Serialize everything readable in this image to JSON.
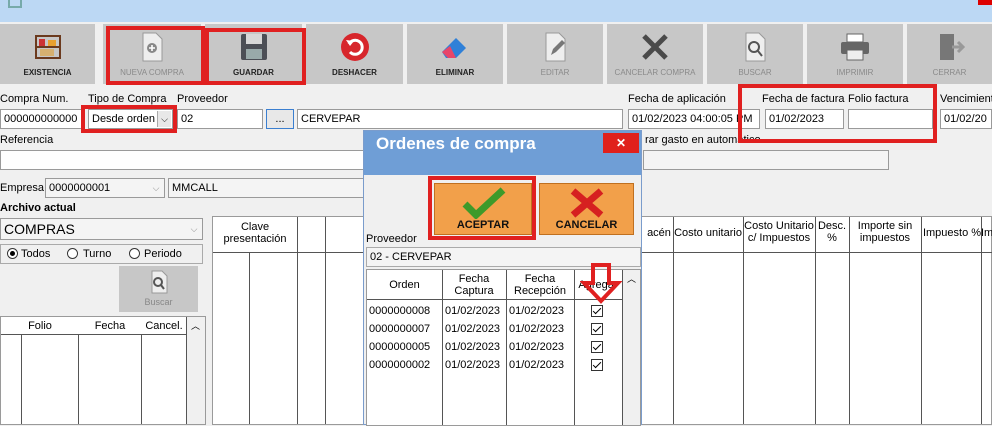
{
  "toolbar": {
    "buttons": [
      {
        "label": "EXISTENCIA",
        "icon": "shelf-icon",
        "enabled": true
      },
      {
        "label": "NUEVA COMPRA",
        "icon": "new-document-icon",
        "enabled": false
      },
      {
        "label": "GUARDAR",
        "icon": "floppy-disk-icon",
        "enabled": true
      },
      {
        "label": "DESHACER",
        "icon": "undo-icon",
        "enabled": true
      },
      {
        "label": "ELIMINAR",
        "icon": "eraser-icon",
        "enabled": true
      },
      {
        "label": "EDITAR",
        "icon": "pencil-document-icon",
        "enabled": false
      },
      {
        "label": "CANCELAR COMPRA",
        "icon": "x-icon",
        "enabled": false
      },
      {
        "label": "BUSCAR",
        "icon": "magnifier-document-icon",
        "enabled": false
      },
      {
        "label": "IMPRIMIR",
        "icon": "printer-icon",
        "enabled": false
      },
      {
        "label": "CERRAR",
        "icon": "exit-door-icon",
        "enabled": false
      }
    ]
  },
  "form": {
    "compra_num_label": "Compra Num.",
    "compra_num_value": "000000000000",
    "tipo_compra_label": "Tipo de Compra",
    "tipo_compra_value": "Desde orden",
    "proveedor_label": "Proveedor",
    "proveedor_code": "02",
    "proveedor_ellipsis": "...",
    "proveedor_name": "CERVEPAR",
    "fecha_aplicacion_label": "Fecha de aplicación",
    "fecha_aplicacion_value": "01/02/2023 04:00:05 PM",
    "fecha_factura_label": "Fecha de factura",
    "fecha_factura_value": "01/02/2023",
    "folio_factura_label": "Folio factura",
    "folio_factura_value": "",
    "vencimiento_label": "Vencimient",
    "vencimiento_value": "01/02/20",
    "referencia_label": "Referencia",
    "gasto_label": "rar gasto en automático",
    "empresa_label": "Empresa",
    "empresa_code": "0000000001",
    "empresa_name": "MMCALL",
    "archivo_actual_label": "Archivo actual",
    "archivo_actual_value": "COMPRAS",
    "radio_todos": "Todos",
    "radio_turno": "Turno",
    "radio_periodo": "Periodo",
    "buscar_label": "Buscar"
  },
  "left_grid": {
    "headers": [
      "Folio",
      "Fecha",
      "Cancel."
    ]
  },
  "main_grid": {
    "headers": [
      "Clave presentación",
      "acén",
      "Costo unitario",
      "Costo Unitario c/ Impuestos",
      "Desc. %",
      "Importe sin impuestos",
      "Impuesto %",
      "Im"
    ]
  },
  "dialog": {
    "title": "Ordenes de compra",
    "close": "✕",
    "accept_label": "ACEPTAR",
    "cancel_label": "CANCELAR",
    "proveedor_label": "Proveedor",
    "proveedor_value": "02 -  CERVEPAR",
    "headers": [
      "Orden",
      "Fecha Captura",
      "Fecha Recepción",
      "Agregar"
    ],
    "rows": [
      {
        "orden": "0000000008",
        "captura": "01/02/2023",
        "recepcion": "01/02/2023",
        "agregar": true
      },
      {
        "orden": "0000000007",
        "captura": "01/02/2023",
        "recepcion": "01/02/2023",
        "agregar": true
      },
      {
        "orden": "0000000005",
        "captura": "01/02/2023",
        "recepcion": "01/02/2023",
        "agregar": true
      },
      {
        "orden": "0000000002",
        "captura": "01/02/2023",
        "recepcion": "01/02/2023",
        "agregar": true
      }
    ]
  },
  "colors": {
    "accent": "#e02020",
    "dialog_title": "#6f9ed6",
    "button_orange": "#f2a04a"
  }
}
